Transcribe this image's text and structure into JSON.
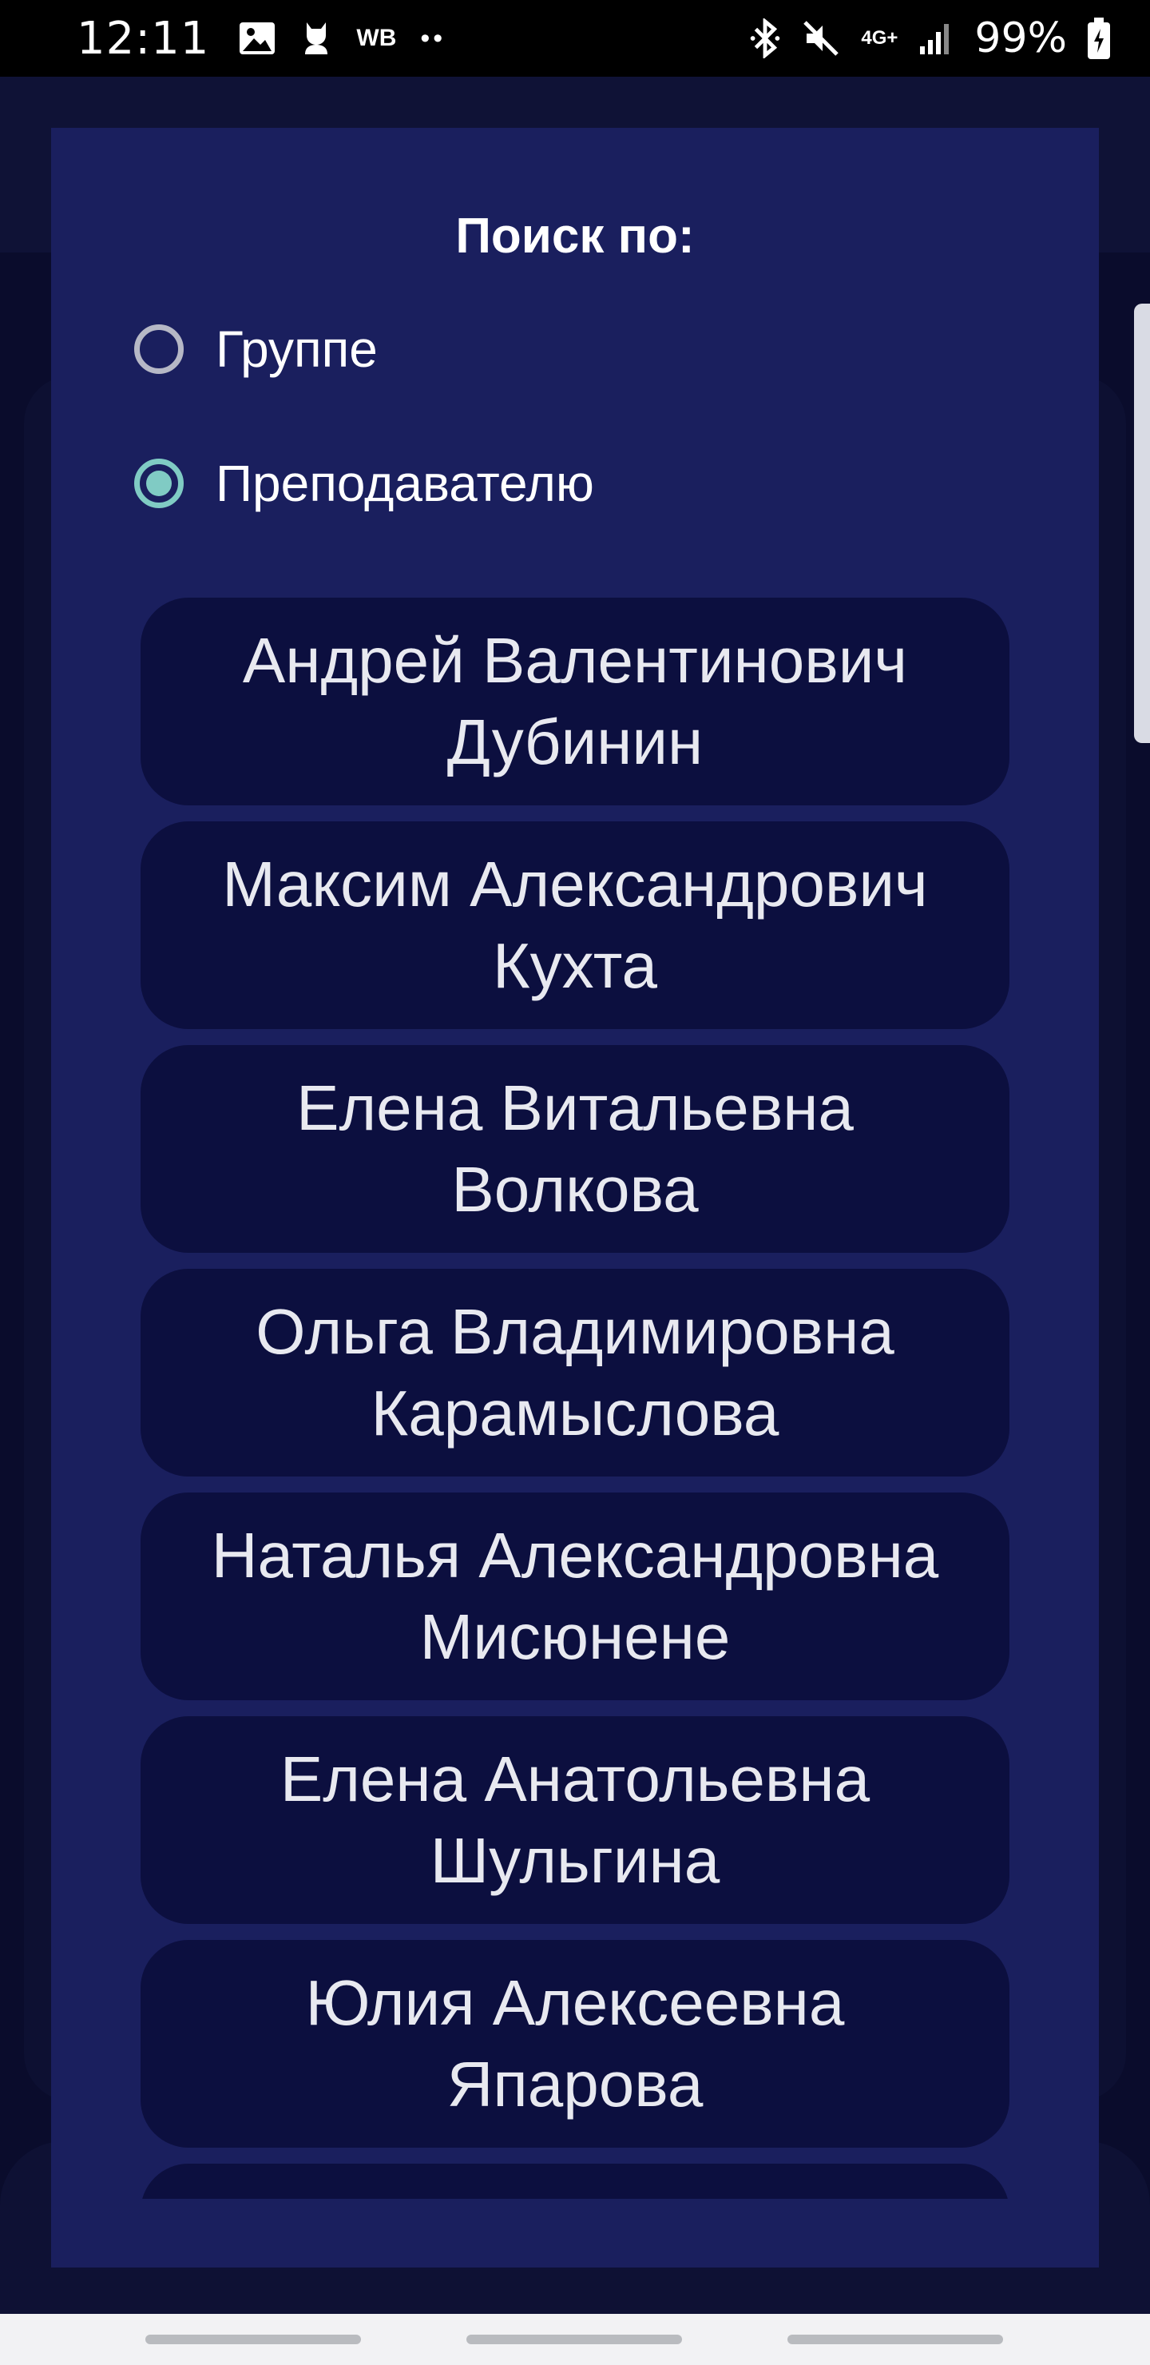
{
  "status_bar": {
    "time": "12:11",
    "carrier_badge": "WB",
    "dots": "••",
    "network": "4G+",
    "battery": "99%",
    "icons": [
      "image-icon",
      "cat-icon",
      "bluetooth-icon",
      "mute-icon",
      "signal-icon",
      "battery-icon"
    ]
  },
  "dialog": {
    "title": "Поиск по:",
    "options": [
      {
        "label": "Группе",
        "checked": false
      },
      {
        "label": "Преподавателю",
        "checked": true
      }
    ],
    "teachers": [
      {
        "line1": "Андрей Валентинович",
        "line2": "Дубинин"
      },
      {
        "line1": "Максим Александрович",
        "line2": "Кухта"
      },
      {
        "line1": "Елена Витальевна",
        "line2": "Волкова"
      },
      {
        "line1": "Ольга Владимировна",
        "line2": "Карамыслова"
      },
      {
        "line1": "Наталья Александровна",
        "line2": "Мисюнене"
      },
      {
        "line1": "Елена Анатольевна",
        "line2": "Шульгина"
      },
      {
        "line1": "Юлия Алексеевна",
        "line2": "Япарова"
      },
      {
        "line1": "",
        "line2": ""
      }
    ]
  },
  "colors": {
    "dialog_bg": "#1a1f5e",
    "item_bg": "#0c0f3f",
    "accent": "#80cbc4",
    "page_bg": "#0a0c2c"
  }
}
